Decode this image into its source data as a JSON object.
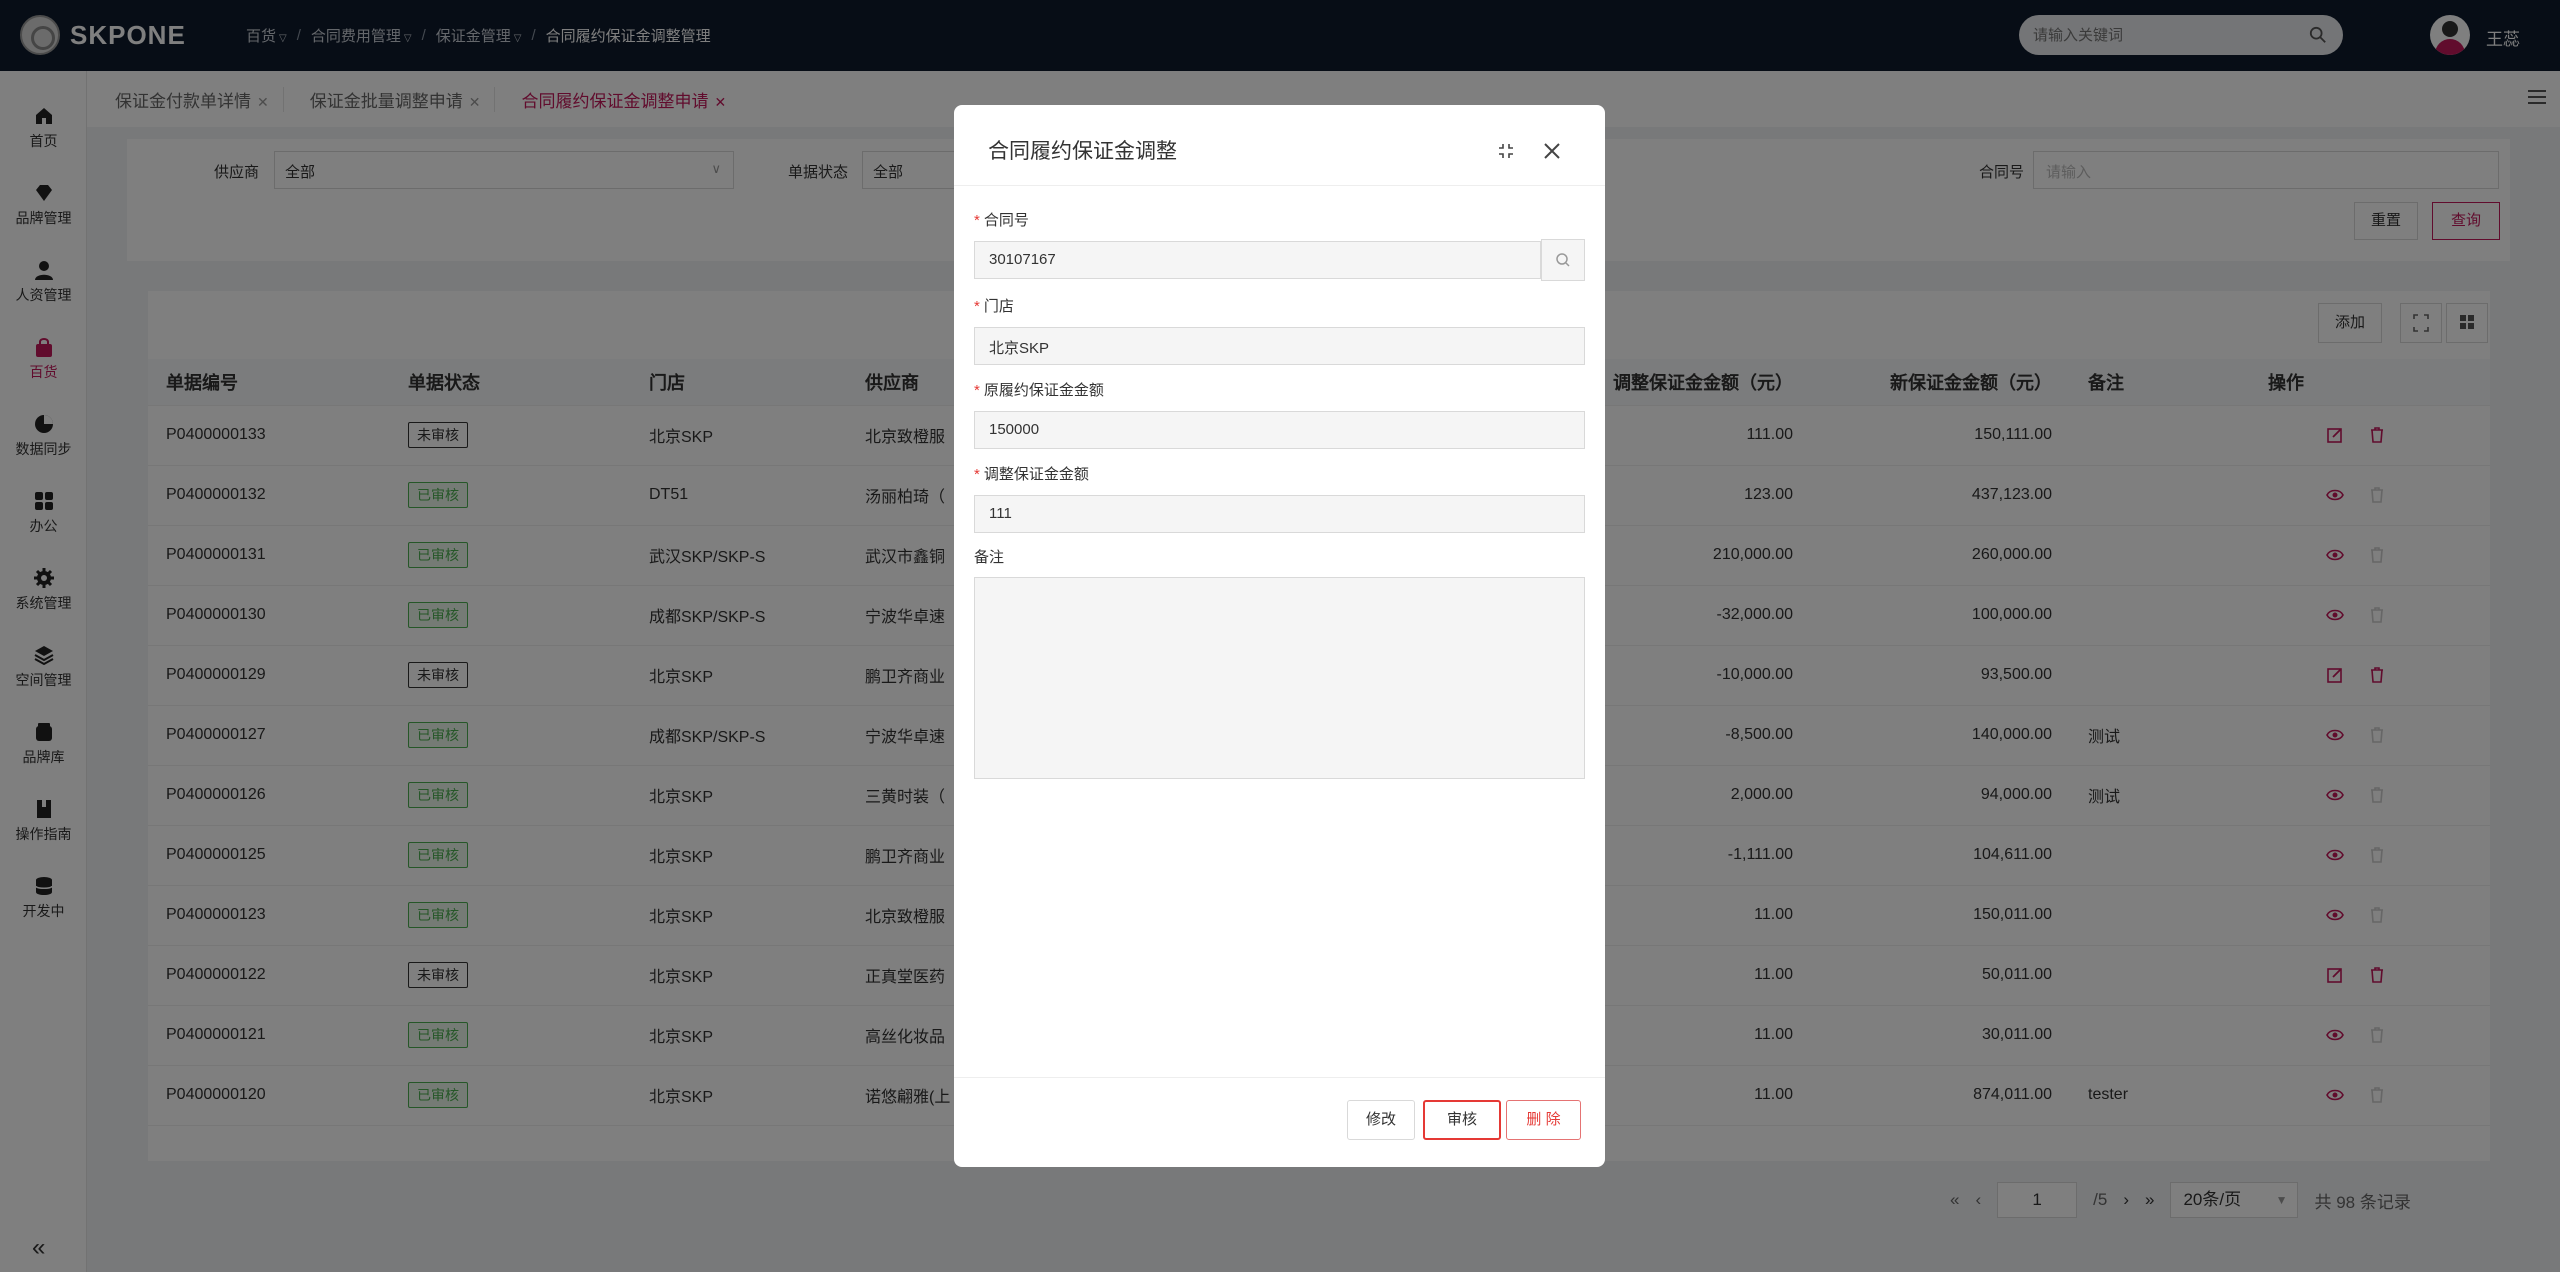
{
  "app": {
    "logo_text": "SKPONE",
    "user_name": "王蕊"
  },
  "breadcrumb": [
    {
      "label": "百货",
      "has_dropdown": true
    },
    {
      "label": "合同费用管理",
      "has_dropdown": true
    },
    {
      "label": "保证金管理",
      "has_dropdown": true
    },
    {
      "label": "合同履约保证金调整管理",
      "has_dropdown": false
    }
  ],
  "search": {
    "placeholder": "请输入关键词"
  },
  "sidebar": {
    "items": [
      {
        "label": "首页",
        "icon": "home-icon"
      },
      {
        "label": "品牌管理",
        "icon": "diamond-icon"
      },
      {
        "label": "人资管理",
        "icon": "person-icon"
      },
      {
        "label": "百货",
        "icon": "bag-icon",
        "active": true
      },
      {
        "label": "数据同步",
        "icon": "pie-icon"
      },
      {
        "label": "办公",
        "icon": "grid-icon"
      },
      {
        "label": "系统管理",
        "icon": "gear-icon"
      },
      {
        "label": "空间管理",
        "icon": "layers-icon"
      },
      {
        "label": "品牌库",
        "icon": "box-icon"
      },
      {
        "label": "操作指南",
        "icon": "book-icon"
      },
      {
        "label": "开发中",
        "icon": "database-icon"
      }
    ],
    "collapse": "«"
  },
  "tabs": [
    {
      "label": "保证金付款单详情",
      "active": false
    },
    {
      "label": "保证金批量调整申请",
      "active": false
    },
    {
      "label": "合同履约保证金调整申请",
      "active": true
    }
  ],
  "filters": {
    "supplier_label": "供应商",
    "supplier_value": "全部",
    "status_label": "单据状态",
    "status_value": "全部",
    "contract_label": "合同号",
    "contract_placeholder": "请输入",
    "reset_label": "重置",
    "query_label": "查询"
  },
  "toolbar": {
    "add_label": "添加"
  },
  "table": {
    "columns": [
      "单据编号",
      "单据状态",
      "门店",
      "供应商",
      "调整保证金金额（元）",
      "新保证金金额（元）",
      "备注",
      "操作"
    ],
    "rows": [
      {
        "id": "P0400000133",
        "status": "未审核",
        "store": "北京SKP",
        "supplier": "北京致橙服",
        "adjust": "111.00",
        "new": "150,111.00",
        "note": "",
        "editable": true
      },
      {
        "id": "P0400000132",
        "status": "已审核",
        "store": "DT51",
        "supplier": "汤丽柏琦（",
        "adjust": "123.00",
        "new": "437,123.00",
        "note": "",
        "editable": false
      },
      {
        "id": "P0400000131",
        "status": "已审核",
        "store": "武汉SKP/SKP-S",
        "supplier": "武汉市鑫铜",
        "adjust": "210,000.00",
        "new": "260,000.00",
        "note": "",
        "editable": false
      },
      {
        "id": "P0400000130",
        "status": "已审核",
        "store": "成都SKP/SKP-S",
        "supplier": "宁波华卓速",
        "adjust": "-32,000.00",
        "new": "100,000.00",
        "note": "",
        "editable": false
      },
      {
        "id": "P0400000129",
        "status": "未审核",
        "store": "北京SKP",
        "supplier": "鹏卫齐商业",
        "adjust": "-10,000.00",
        "new": "93,500.00",
        "note": "",
        "editable": true
      },
      {
        "id": "P0400000127",
        "status": "已审核",
        "store": "成都SKP/SKP-S",
        "supplier": "宁波华卓速",
        "adjust": "-8,500.00",
        "new": "140,000.00",
        "note": "测试",
        "editable": false
      },
      {
        "id": "P0400000126",
        "status": "已审核",
        "store": "北京SKP",
        "supplier": "三黄时装（",
        "adjust": "2,000.00",
        "new": "94,000.00",
        "note": "测试",
        "editable": false
      },
      {
        "id": "P0400000125",
        "status": "已审核",
        "store": "北京SKP",
        "supplier": "鹏卫齐商业",
        "adjust": "-1,111.00",
        "new": "104,611.00",
        "note": "",
        "editable": false
      },
      {
        "id": "P0400000123",
        "status": "已审核",
        "store": "北京SKP",
        "supplier": "北京致橙服",
        "adjust": "11.00",
        "new": "150,011.00",
        "note": "",
        "editable": false
      },
      {
        "id": "P0400000122",
        "status": "未审核",
        "store": "北京SKP",
        "supplier": "正真堂医药",
        "adjust": "11.00",
        "new": "50,011.00",
        "note": "",
        "editable": true
      },
      {
        "id": "P0400000121",
        "status": "已审核",
        "store": "北京SKP",
        "supplier": "高丝化妆品",
        "adjust": "11.00",
        "new": "30,011.00",
        "note": "",
        "editable": false
      },
      {
        "id": "P0400000120",
        "status": "已审核",
        "store": "北京SKP",
        "supplier": "诺悠翩雅(上",
        "adjust": "11.00",
        "new": "874,011.00",
        "note": "tester",
        "editable": false
      }
    ]
  },
  "pagination": {
    "current_page": "1",
    "total_pages": "/5",
    "page_size": "20条/页",
    "total": "共 98 条记录"
  },
  "modal": {
    "title": "合同履约保证金调整",
    "contract_label": "合同号",
    "contract_value": "30107167",
    "store_label": "门店",
    "store_value": "北京SKP",
    "original_label": "原履约保证金金额",
    "original_value": "150000",
    "adjust_label": "调整保证金金额",
    "adjust_value": "111",
    "note_label": "备注",
    "note_value": "",
    "modify_label": "修改",
    "audit_label": "审核",
    "delete_label": "删 除"
  },
  "colors": {
    "accent": "#c2185b",
    "topbar": "#0f1b2d",
    "approved": "#4caf50",
    "danger": "#e53935"
  }
}
